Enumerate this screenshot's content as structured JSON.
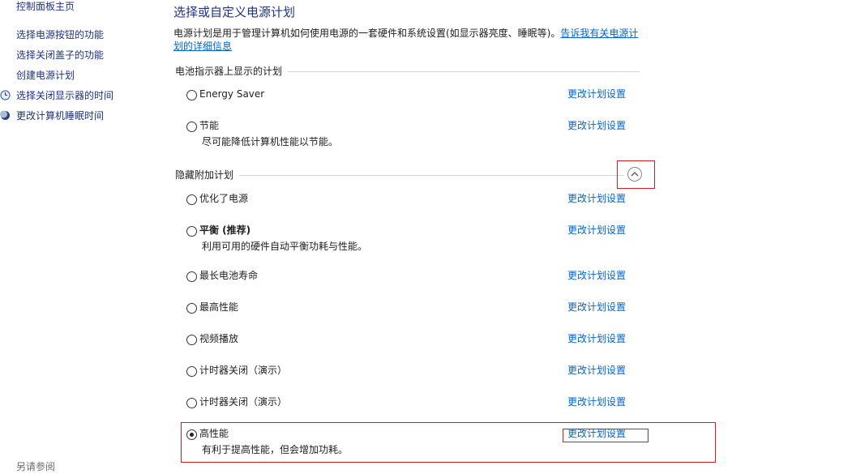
{
  "nav": {
    "home": "控制面板主页",
    "links": [
      {
        "label": "选择电源按钮的功能",
        "icon": ""
      },
      {
        "label": "选择关闭盖子的功能",
        "icon": ""
      },
      {
        "label": "创建电源计划",
        "icon": ""
      },
      {
        "label": "选择关闭显示器的时间",
        "icon": "clock-icon"
      },
      {
        "label": "更改计算机睡眠时间",
        "icon": "moon-icon"
      }
    ],
    "see_also": "另请参阅"
  },
  "main": {
    "title": "选择或自定义电源计划",
    "description": "电源计划是用于管理计算机如何使用电源的一套硬件和系统设置(如显示器亮度、睡眠等)。",
    "description_link": "告诉我有关电源计划的详细信息",
    "battery_group": {
      "header": "电池指示器上显示的计划",
      "plans": [
        {
          "name": "Energy Saver",
          "desc": "",
          "link": "更改计划设置",
          "selected": false
        },
        {
          "name": "节能",
          "desc": "尽可能降低计算机性能以节能。",
          "link": "更改计划设置",
          "selected": false
        }
      ]
    },
    "hidden_group": {
      "header": "隐藏附加计划",
      "plans": [
        {
          "name": "优化了电源",
          "desc": "",
          "link": "更改计划设置",
          "selected": false
        },
        {
          "name": "平衡 (推荐)",
          "desc": "利用可用的硬件自动平衡功耗与性能。",
          "link": "更改计划设置",
          "selected": false
        },
        {
          "name": "最长电池寿命",
          "desc": "",
          "link": "更改计划设置",
          "selected": false
        },
        {
          "name": "最高性能",
          "desc": "",
          "link": "更改计划设置",
          "selected": false
        },
        {
          "name": "视频播放",
          "desc": "",
          "link": "更改计划设置",
          "selected": false
        },
        {
          "name": "计时器关闭（演示）",
          "desc": "",
          "link": "更改计划设置",
          "selected": false
        },
        {
          "name": "计时器关闭（演示）",
          "desc": "",
          "link": "更改计划设置",
          "selected": false
        },
        {
          "name": "高性能",
          "desc": "有利于提高性能，但会增加功耗。",
          "link": "更改计划设置",
          "selected": true
        }
      ]
    }
  },
  "colors": {
    "nav_link": "#1e3287",
    "link": "#0066cc",
    "annotation": "#d21e1e"
  }
}
